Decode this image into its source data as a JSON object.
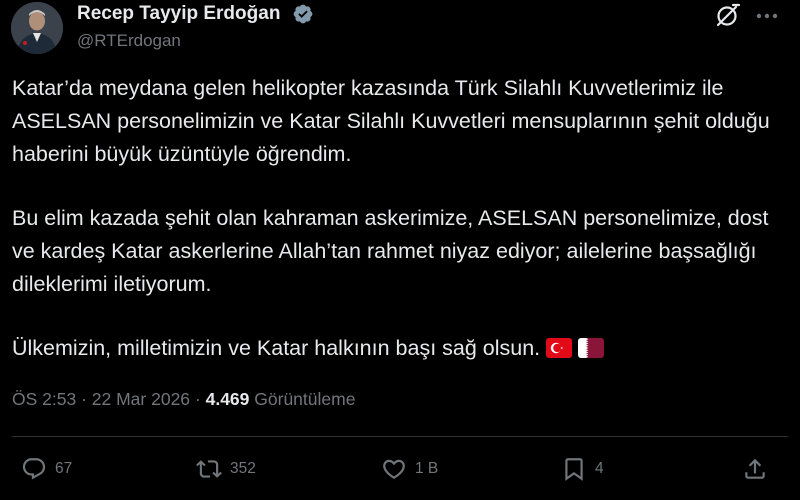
{
  "author": {
    "display_name": "Recep Tayyip Erdoğan",
    "handle": "@RTErdogan",
    "verified_icon": "verified-badge-icon",
    "colors": {
      "verified": "#829aab"
    }
  },
  "header_icons": {
    "grok": "grok-icon",
    "more": "more-options-icon"
  },
  "tweet": {
    "paragraphs": [
      "Katar’da meydana gelen helikopter kazasında Türk Silahlı Kuvvetlerimiz ile ASELSAN personelimizin ve Katar Silahlı Kuvvetleri mensuplarının şehit olduğu haberini büyük üzüntüyle öğrendim.",
      "Bu elim kazada şehit olan kahraman askerimize, ASELSAN personelimize, dost ve kardeş Katar askerlerine Allah’tan rahmet niyaz ediyor; ailelerine başsağlığı dileklerimi iletiyorum.",
      "Ülkemizin, milletimizin ve Katar halkının başı sağ olsun."
    ],
    "flags": [
      "flag-turkey",
      "flag-qatar"
    ]
  },
  "meta": {
    "time": "ÖS 2:53",
    "separator": " · ",
    "date": "22 Mar 2026",
    "views_count": "4.469",
    "views_label": " Görüntüleme"
  },
  "actions": {
    "reply": {
      "icon": "reply-icon",
      "count": "67"
    },
    "retweet": {
      "icon": "retweet-icon",
      "count": "352"
    },
    "like": {
      "icon": "heart-icon",
      "count": "1 B"
    },
    "bookmark": {
      "icon": "bookmark-icon",
      "count": "4"
    },
    "share": {
      "icon": "share-icon"
    }
  },
  "colors": {
    "background": "#000000",
    "text_primary": "#e7e9ea",
    "text_secondary": "#71767b",
    "divider": "#2f3336"
  }
}
